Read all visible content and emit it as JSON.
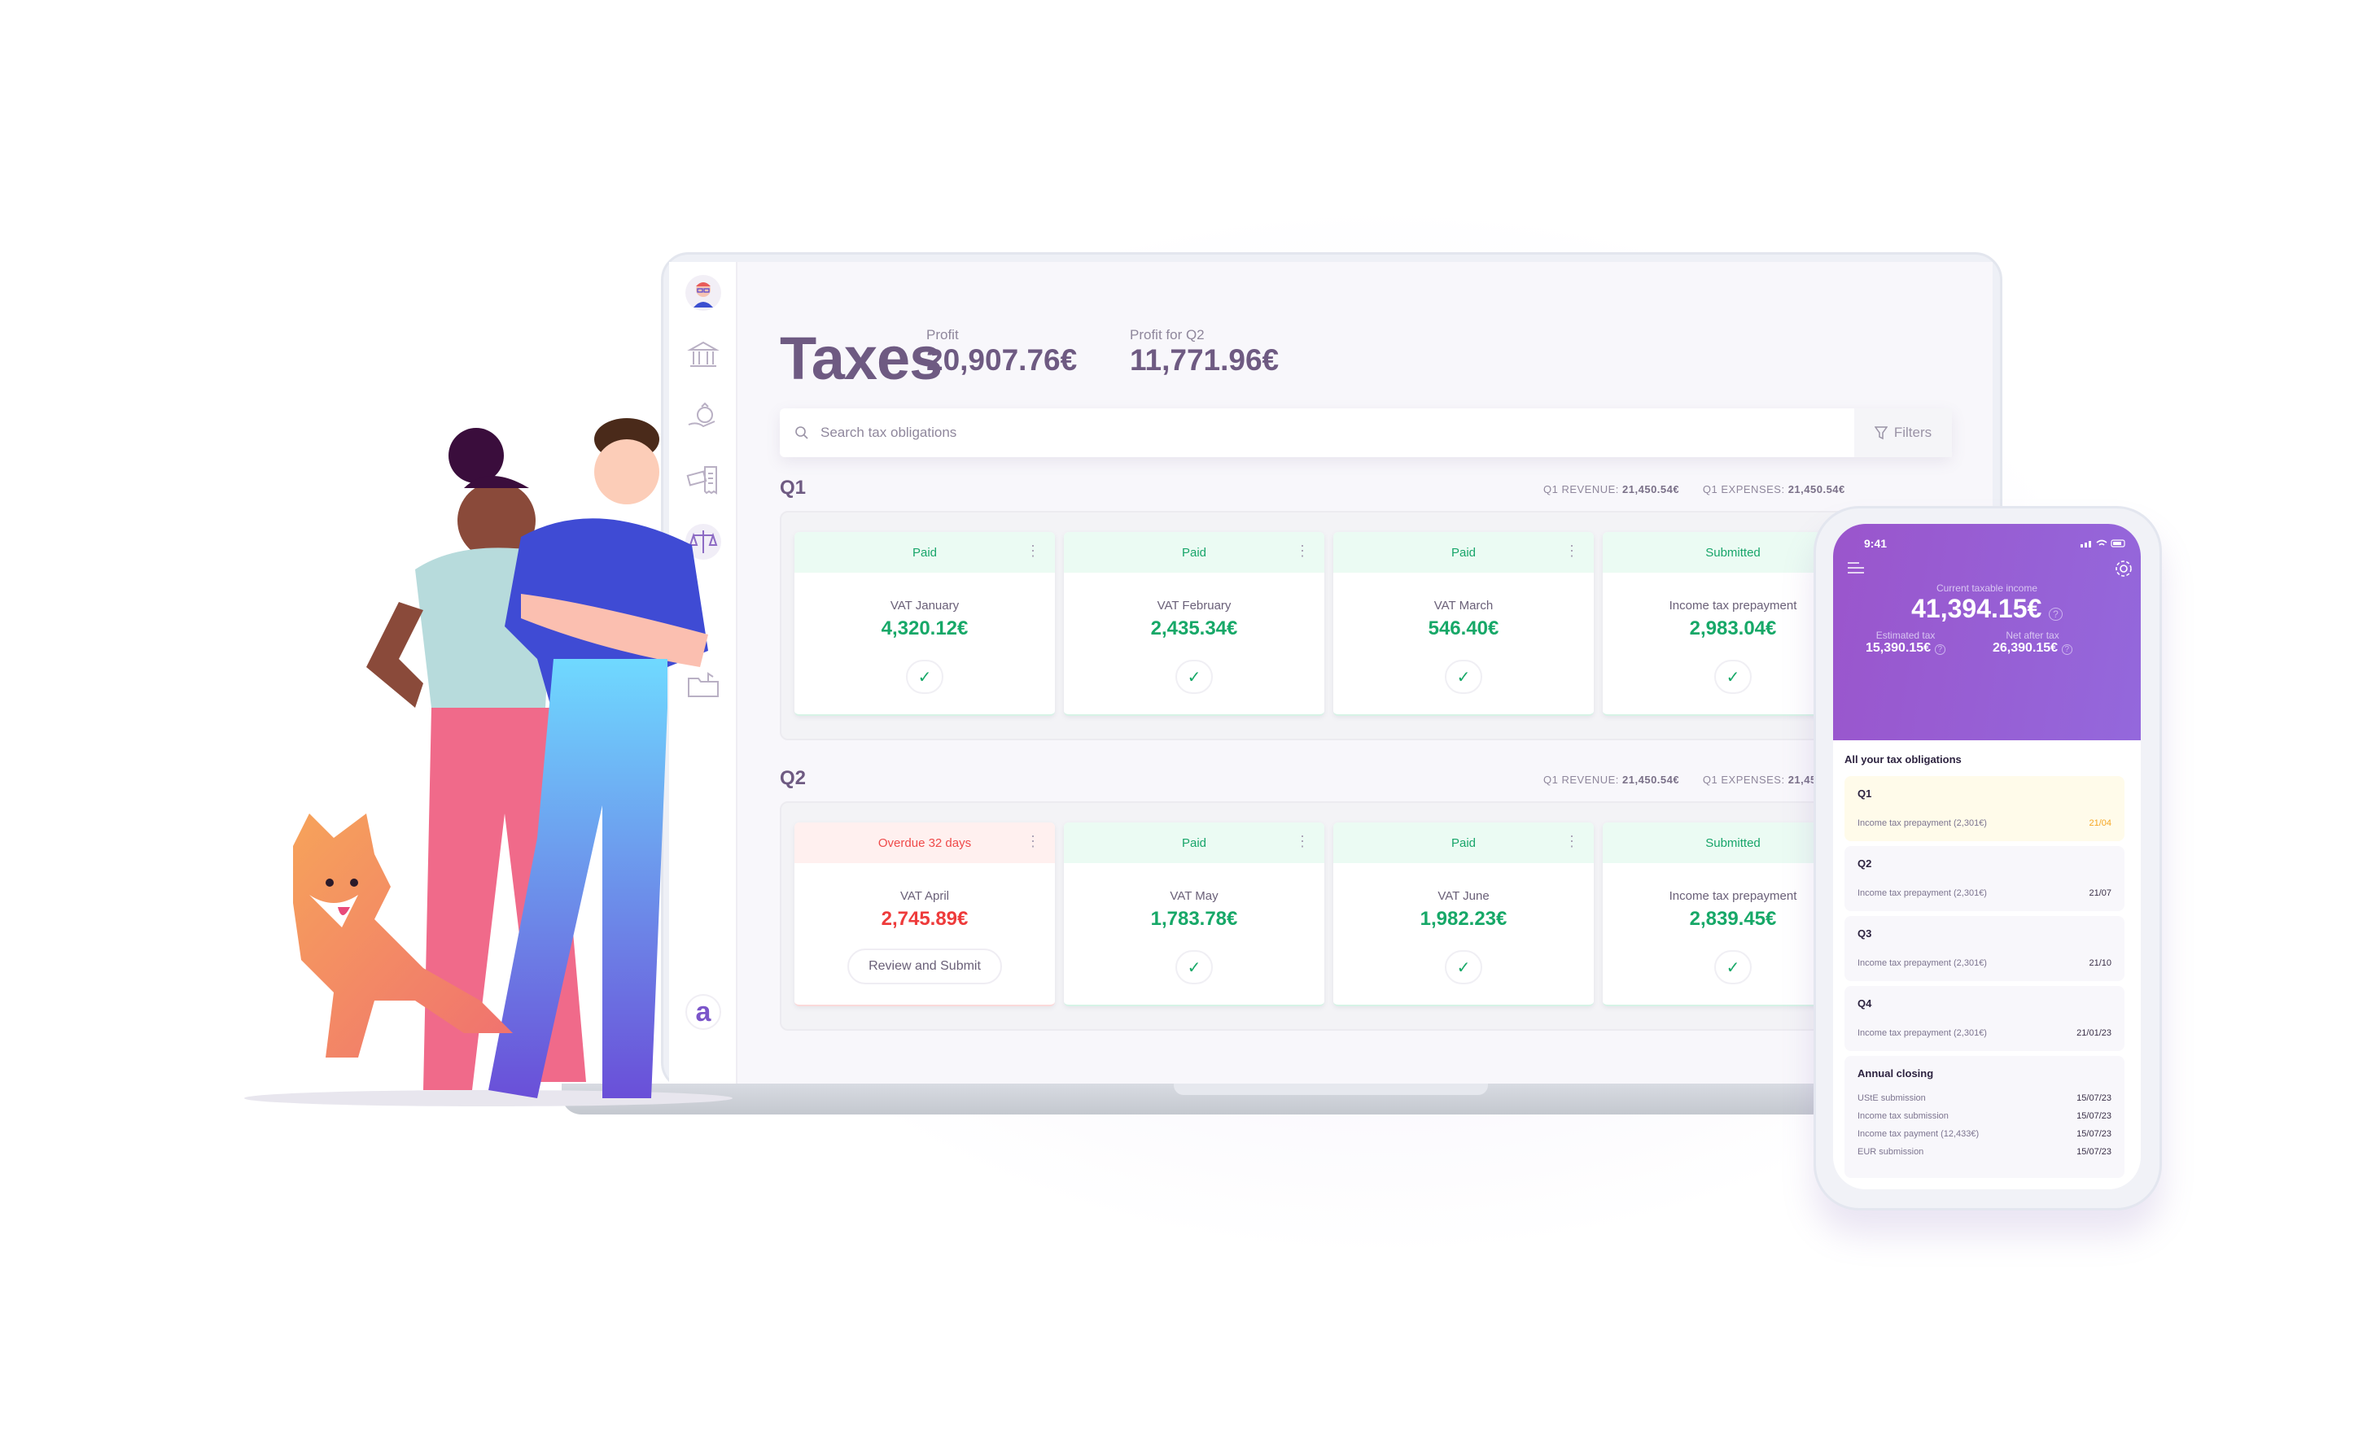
{
  "page": {
    "title": "Taxes"
  },
  "stats": [
    {
      "label": "Profit",
      "value": "20,907.76€"
    },
    {
      "label": "Profit for Q2",
      "value": "11,771.96€"
    }
  ],
  "sidebar": {
    "items": [
      {
        "icon": "avatar"
      },
      {
        "icon": "bank-icon"
      },
      {
        "icon": "money-bag-hand-icon"
      },
      {
        "icon": "card-receipt-icon"
      },
      {
        "icon": "scales-icon"
      },
      {
        "icon": "folder-icon"
      }
    ],
    "logo": "a"
  },
  "search": {
    "placeholder": "Search tax obligations",
    "filters_label": "Filters"
  },
  "colors": {
    "accent": "#6e5a82",
    "paid": "#17a868",
    "overdue": "#ee3b3b",
    "phone_header": "#9a55cc",
    "due_soon": "#f5a623"
  },
  "quarters": [
    {
      "label": "Q1",
      "revenue_label": "Q1 REVENUE:",
      "revenue": "21,450.54€",
      "expenses_label": "Q1 EXPENSES:",
      "expenses": "21,450.54€",
      "cards": [
        {
          "status": "Paid",
          "name": "VAT January",
          "amount": "4,320.12€",
          "state": "paid"
        },
        {
          "status": "Paid",
          "name": "VAT February",
          "amount": "2,435.34€",
          "state": "paid"
        },
        {
          "status": "Paid",
          "name": "VAT March",
          "amount": "546.40€",
          "state": "paid"
        },
        {
          "status": "Submitted",
          "name": "Income tax prepayment",
          "amount": "2,983.04€",
          "state": "paid"
        }
      ]
    },
    {
      "label": "Q2",
      "revenue_label": "Q1 REVENUE:",
      "revenue": "21,450.54€",
      "expenses_label": "Q1 EXPENSES:",
      "expenses": "21,450.54€",
      "cards": [
        {
          "status": "Overdue 32 days",
          "name": "VAT April",
          "amount": "2,745.89€",
          "state": "overdue",
          "action": "Review and Submit"
        },
        {
          "status": "Paid",
          "name": "VAT May",
          "amount": "1,783.78€",
          "state": "paid"
        },
        {
          "status": "Paid",
          "name": "VAT June",
          "amount": "1,982.23€",
          "state": "paid"
        },
        {
          "status": "Submitted",
          "name": "Income tax prepayment",
          "amount": "2,839.45€",
          "state": "paid"
        }
      ]
    }
  ],
  "phone": {
    "time": "9:41",
    "income_label": "Current taxable income",
    "income": "41,394.15€",
    "estimated_label": "Estimated tax",
    "estimated": "15,390.15€",
    "net_label": "Net after tax",
    "net": "26,390.15€",
    "list_title": "All your tax obligations",
    "quarters": [
      {
        "q": "Q1",
        "item": "Income tax prepayment (2,301€)",
        "date": "21/04",
        "highlight": true
      },
      {
        "q": "Q2",
        "item": "Income tax prepayment (2,301€)",
        "date": "21/07"
      },
      {
        "q": "Q3",
        "item": "Income tax prepayment (2,301€)",
        "date": "21/10"
      },
      {
        "q": "Q4",
        "item": "Income tax prepayment (2,301€)",
        "date": "21/01/23"
      }
    ],
    "annual": {
      "title": "Annual closing",
      "rows": [
        {
          "item": "UStE submission",
          "date": "15/07/23"
        },
        {
          "item": "Income tax submission",
          "date": "15/07/23"
        },
        {
          "item": "Income tax payment (12,433€)",
          "date": "15/07/23"
        },
        {
          "item": "EUR submission",
          "date": "15/07/23"
        }
      ]
    }
  }
}
